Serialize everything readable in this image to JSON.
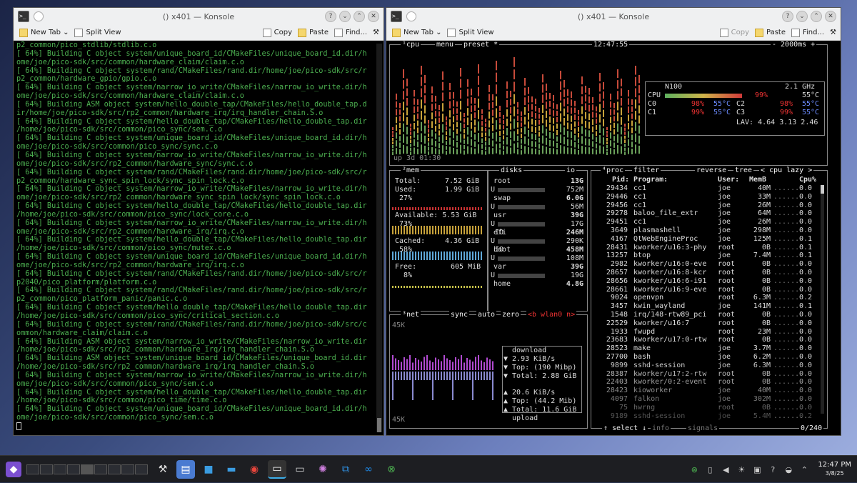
{
  "left_window": {
    "title": "() x401 — Konsole",
    "toolbar": {
      "new_tab": "New Tab",
      "split_view": "Split View",
      "copy": "Copy",
      "paste": "Paste",
      "find": "Find..."
    },
    "lines": [
      "p2_common/pico_stdlib/stdlib.c.o",
      "[ 64%] Building C object system/unique_board_id/CMakeFiles/unique_board_id.dir/h",
      "ome/joe/pico-sdk/src/common/hardware_claim/claim.c.o",
      "[ 64%] Building C object system/rand/CMakeFiles/rand.dir/home/joe/pico-sdk/src/r",
      "p2_common/hardware_gpio/gpio.c.o",
      "[ 64%] Building C object system/narrow_io_write/CMakeFiles/narrow_io_write.dir/h",
      "ome/joe/pico-sdk/src/common/hardware_claim/claim.c.o",
      "[ 64%] Building ASM object system/hello_double_tap/CMakeFiles/hello_double_tap.d",
      "ir/home/joe/pico-sdk/src/rp2_common/hardware_irq/irq_handler_chain.S.o",
      "[ 64%] Building C object system/hello_double_tap/CMakeFiles/hello_double_tap.dir",
      "/home/joe/pico-sdk/src/common/pico_sync/sem.c.o",
      "[ 64%] Building C object system/unique_board_id/CMakeFiles/unique_board_id.dir/h",
      "ome/joe/pico-sdk/src/common/pico_sync/sync.c.o",
      "[ 64%] Building C object system/narrow_io_write/CMakeFiles/narrow_io_write.dir/h",
      "ome/joe/pico-sdk/src/rp2_common/hardware_sync/sync.c.o",
      "[ 64%] Building C object system/rand/CMakeFiles/rand.dir/home/joe/pico-sdk/src/r",
      "p2_common/hardware_sync_spin_lock/sync_spin_lock.c.o",
      "[ 64%] Building C object system/narrow_io_write/CMakeFiles/narrow_io_write.dir/h",
      "ome/joe/pico-sdk/src/rp2_common/hardware_sync_spin_lock/sync_spin_lock.c.o",
      "[ 64%] Building C object system/hello_double_tap/CMakeFiles/hello_double_tap.dir",
      "/home/joe/pico-sdk/src/common/pico_sync/lock_core.c.o",
      "[ 64%] Building C object system/narrow_io_write/CMakeFiles/narrow_io_write.dir/h",
      "ome/joe/pico-sdk/src/rp2_common/hardware_irq/irq.c.o",
      "[ 64%] Building C object system/hello_double_tap/CMakeFiles/hello_double_tap.dir",
      "/home/joe/pico-sdk/src/common/pico_sync/mutex.c.o",
      "[ 64%] Building C object system/unique_board_id/CMakeFiles/unique_board_id.dir/h",
      "ome/joe/pico-sdk/src/rp2_common/hardware_irq/irq.c.o",
      "[ 64%] Building C object system/rand/CMakeFiles/rand.dir/home/joe/pico-sdk/src/r",
      "p2040/pico_platform/platform.c.o",
      "[ 64%] Building C object system/rand/CMakeFiles/rand.dir/home/joe/pico-sdk/src/r",
      "p2_common/pico_platform_panic/panic.c.o",
      "[ 64%] Building C object system/hello_double_tap/CMakeFiles/hello_double_tap.dir",
      "/home/joe/pico-sdk/src/common/pico_sync/critical_section.c.o",
      "[ 64%] Building C object system/rand/CMakeFiles/rand.dir/home/joe/pico-sdk/src/c",
      "ommon/hardware_claim/claim.c.o",
      "[ 64%] Building ASM object system/narrow_io_write/CMakeFiles/narrow_io_write.dir",
      "/home/joe/pico-sdk/src/rp2_common/hardware_irq/irq_handler_chain.S.o",
      "[ 64%] Building ASM object system/unique_board_id/CMakeFiles/unique_board_id.dir",
      "/home/joe/pico-sdk/src/rp2_common/hardware_irq/irq_handler_chain.S.o",
      "[ 64%] Building C object system/narrow_io_write/CMakeFiles/narrow_io_write.dir/h",
      "ome/joe/pico-sdk/src/common/pico_sync/sem.c.o",
      "[ 64%] Building C object system/hello_double_tap/CMakeFiles/hello_double_tap.dir",
      "/home/joe/pico-sdk/src/common/pico_time/time.c.o",
      "[ 64%] Building C object system/unique_board_id/CMakeFiles/unique_board_id.dir/h",
      "ome/joe/pico-sdk/src/common/pico_sync/sem.c.o"
    ]
  },
  "right_window": {
    "title": "() x401 — Konsole",
    "toolbar": {
      "new_tab": "New Tab",
      "split_view": "Split View",
      "copy": "Copy",
      "paste": "Paste",
      "find": "Find..."
    },
    "btop": {
      "cpu_box": {
        "label1": "¹cpu",
        "label2": "menu",
        "label3": "preset *",
        "clock": "12:47:55",
        "interval": "- 2000ms +",
        "uptime": "up 3d 01:30"
      },
      "cpu_info": {
        "model": "N100",
        "freq": "2.1 GHz",
        "cpu_label": "CPU",
        "cpu_pct": "99%",
        "cpu_temp": "55°C",
        "cores": [
          {
            "n": "C0",
            "pct": "98%",
            "temp": "55°C"
          },
          {
            "n": "C2",
            "pct": "98%",
            "temp": "55°C"
          },
          {
            "n": "C1",
            "pct": "99%",
            "temp": "55°C"
          },
          {
            "n": "C3",
            "pct": "99%",
            "temp": "55°C"
          }
        ],
        "lav": "LAV: 4.64 3.13 2.46"
      },
      "mem": {
        "label": "²mem",
        "total_l": "Total:",
        "total": "7.52 GiB",
        "used_l": "Used:",
        "used": "1.99 GiB",
        "used_pct": "27%",
        "avail_l": "Available: 5.53 GiB",
        "avail_pct": "73%",
        "cached_l": "Cached:",
        "cached": "4.36 GiB",
        "cached_pct": "58%",
        "free_l": "Free:",
        "free": "605 MiB",
        "free_pct": "8%"
      },
      "disks": {
        "label": "disks",
        "io": "io",
        "items": [
          {
            "name": "root",
            "size": "13G",
            "u": "752M",
            "io": ""
          },
          {
            "name": "swap",
            "size": "6.0G",
            "u": "56M",
            "io": ""
          },
          {
            "name": "usr",
            "size": "39G",
            "u": "17G",
            "io": ""
          },
          {
            "name": "efi",
            "size": "246M",
            "u": "",
            "io": "IO"
          },
          {
            "name": "",
            "size": "",
            "u": "290K",
            "io": ""
          },
          {
            "name": "boot",
            "size": "458M",
            "u": "",
            "io": "IO"
          },
          {
            "name": "",
            "size": "",
            "u": "108M",
            "io": ""
          },
          {
            "name": "var",
            "size": "39G",
            "u": "19G",
            "io": ""
          },
          {
            "name": "home",
            "size": "4.8G",
            "u": "",
            "io": ""
          }
        ]
      },
      "net": {
        "label": "³net",
        "sync": "sync",
        "auto": "auto",
        "zero": "zero",
        "iface": "<b wlan0 n>",
        "scale_top": "45K",
        "scale_bottom": "45K",
        "download": "download",
        "dl_rate": "▼ 2.93 KiB/s",
        "dl_top": "▼ Top: (190 Mibp)",
        "dl_total": "▼ Total: 2.88 GiB",
        "ul_rate": "▲ 20.6 KiB/s",
        "ul_top": "▲ Top: (44.2 Mib)",
        "ul_total": "▲ Total: 11.6 GiB",
        "upload": "upload"
      },
      "proc": {
        "label": "⁴proc",
        "filter": "filter",
        "reverse": "reverse",
        "tree": "tree",
        "sort": "< cpu lazy >",
        "headers": {
          "pid": "Pid:",
          "prog": "Program:",
          "user": "User:",
          "mem": "MemB",
          "cpu": "Cpu%"
        },
        "rows": [
          [
            "29434",
            "cc1",
            "joe",
            "40M",
            "0.0"
          ],
          [
            "29446",
            "cc1",
            "joe",
            "33M",
            "0.0"
          ],
          [
            "29456",
            "cc1",
            "joe",
            "26M",
            "0.0"
          ],
          [
            "29278",
            "baloo_file_extr",
            "joe",
            "64M",
            "0.0"
          ],
          [
            "29451",
            "cc1",
            "joe",
            "26M",
            "0.0"
          ],
          [
            "3649",
            "plasmashell",
            "joe",
            "298M",
            "0.0"
          ],
          [
            "4167",
            "QtWebEngineProc",
            "joe",
            "125M",
            "0.1"
          ],
          [
            "28431",
            "kworker/u16:3-phy",
            "root",
            "0B",
            "0.1"
          ],
          [
            "13257",
            "btop",
            "joe",
            "7.4M",
            "0.1"
          ],
          [
            "2982",
            "kworker/u16:0-eve",
            "root",
            "0B",
            "0.0"
          ],
          [
            "28657",
            "kworker/u16:8-kcr",
            "root",
            "0B",
            "0.0"
          ],
          [
            "28656",
            "kworker/u16:6-i91",
            "root",
            "0B",
            "0.0"
          ],
          [
            "28661",
            "kworker/u16:9-eve",
            "root",
            "0B",
            "0.0"
          ],
          [
            "9024",
            "openvpn",
            "root",
            "6.3M",
            "0.2"
          ],
          [
            "3457",
            "kwin_wayland",
            "joe",
            "141M",
            "0.1"
          ],
          [
            "1548",
            "irq/148-rtw89_pci",
            "root",
            "0B",
            "0.0"
          ],
          [
            "22529",
            "kworker/u16:7",
            "root",
            "0B",
            "0.0"
          ],
          [
            "1933",
            "fwupd",
            "root",
            "23M",
            "0.0"
          ],
          [
            "23683",
            "kworker/u17:0-rtw",
            "root",
            "0B",
            "0.0"
          ],
          [
            "28523",
            "make",
            "joe",
            "3.7M",
            "0.0"
          ],
          [
            "27700",
            "bash",
            "joe",
            "6.2M",
            "0.0"
          ],
          [
            "9899",
            "sshd-session",
            "joe",
            "6.3M",
            "0.0"
          ],
          [
            "28387",
            "kworker/u17:2-rtw",
            "root",
            "0B",
            "0.0"
          ],
          [
            "22403",
            "kworker/0:2-event",
            "root",
            "0B",
            "0.0"
          ],
          [
            "28423",
            "kioworker",
            "joe",
            "40M",
            "0.0"
          ],
          [
            "4097",
            "falkon",
            "joe",
            "302M",
            "0.0"
          ],
          [
            "75",
            "hwrng",
            "root",
            "0B",
            "0.0"
          ],
          [
            "9189",
            "sshd-session",
            "joe",
            "5.4M",
            "0.2"
          ]
        ],
        "footer_select": "↑ select ↓",
        "footer_info": "info",
        "footer_signals": "signals",
        "count": "0/240"
      }
    }
  },
  "taskbar": {
    "time": "12:47 PM",
    "date": "3/8/25"
  },
  "colors": {
    "green": "#4caf50",
    "accent": "#e33"
  }
}
